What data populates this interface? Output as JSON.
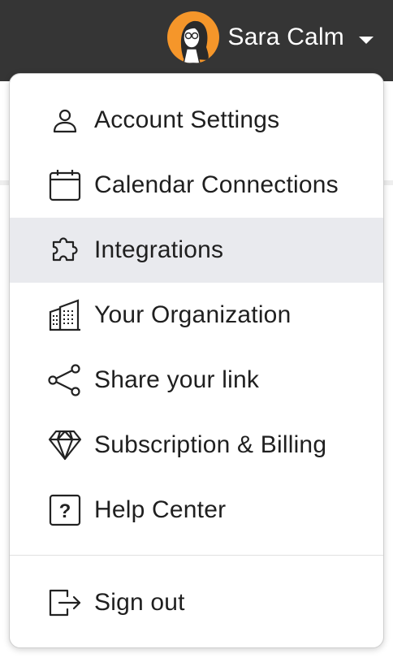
{
  "user": {
    "name": "Sara Calm",
    "avatar_icon": "avatar-portrait-icon",
    "avatar_color": "#f5962a"
  },
  "menu": {
    "items": [
      {
        "label": "Account Settings",
        "icon": "user-icon"
      },
      {
        "label": "Calendar Connections",
        "icon": "calendar-icon"
      },
      {
        "label": "Integrations",
        "icon": "puzzle-icon",
        "highlighted": true
      },
      {
        "label": "Your Organization",
        "icon": "building-icon"
      },
      {
        "label": "Share your link",
        "icon": "share-icon"
      },
      {
        "label": "Subscription & Billing",
        "icon": "diamond-icon"
      },
      {
        "label": "Help Center",
        "icon": "help-icon"
      }
    ],
    "sign_out": {
      "label": "Sign out",
      "icon": "sign-out-icon"
    }
  },
  "colors": {
    "topbar": "#353535",
    "highlight": "#e9eaee",
    "text": "#1f1f1f"
  }
}
